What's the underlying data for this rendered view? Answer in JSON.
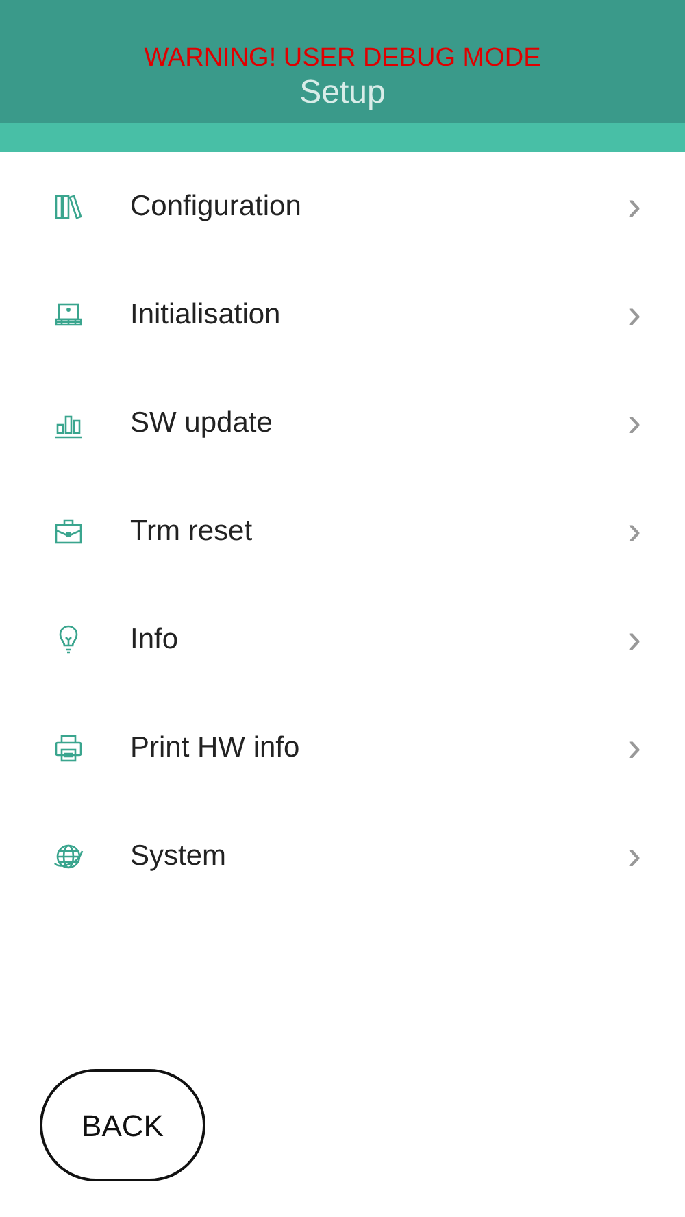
{
  "header": {
    "title": "Setup",
    "warning": "WARNING! USER DEBUG MODE"
  },
  "menu": [
    {
      "kind": "books",
      "label": "Configuration",
      "chevron": "›"
    },
    {
      "kind": "laptop",
      "label": "Initialisation",
      "chevron": "›"
    },
    {
      "kind": "chart",
      "label": "SW update",
      "chevron": "›"
    },
    {
      "kind": "briefcase",
      "label": "Trm reset",
      "chevron": "›"
    },
    {
      "kind": "bulb",
      "label": "Info",
      "chevron": "›"
    },
    {
      "kind": "printer",
      "label": "Print HW info",
      "chevron": "›"
    },
    {
      "kind": "globe",
      "label": "System",
      "chevron": "›"
    }
  ],
  "back_button": "BACK"
}
